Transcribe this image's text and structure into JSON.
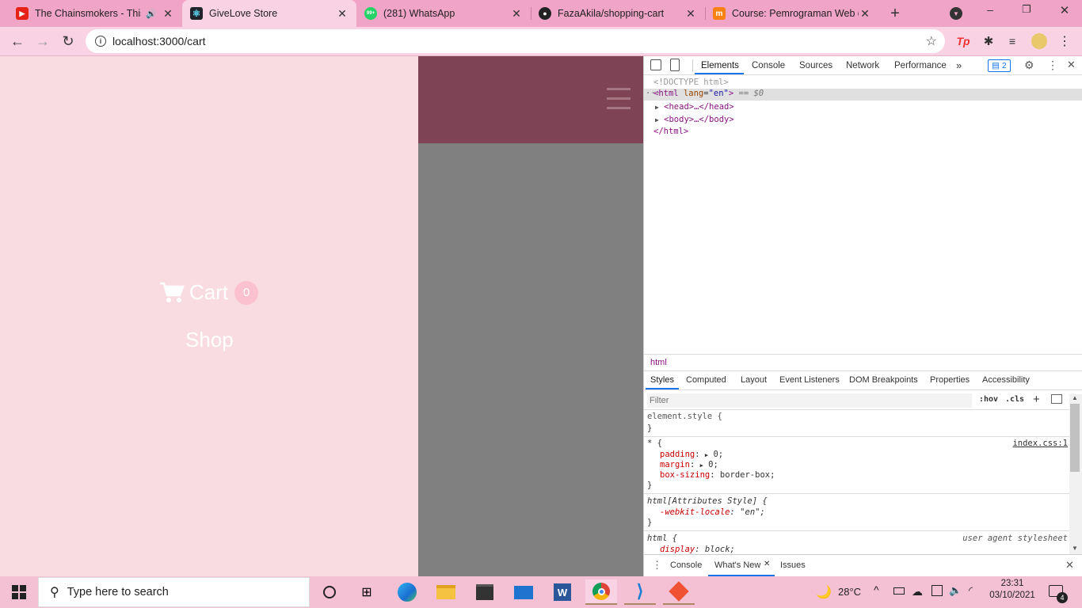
{
  "browser": {
    "tabs": [
      {
        "title": "The Chainsmokers - This",
        "icon": "youtube-icon"
      },
      {
        "title": "GiveLove Store",
        "icon": "react-icon"
      },
      {
        "title": "(281) WhatsApp",
        "icon": "whatsapp-icon",
        "badge": "99+"
      },
      {
        "title": "FazaAkila/shopping-cart",
        "icon": "github-icon"
      },
      {
        "title": "Course: Pemrograman Web d",
        "icon": "moodle-icon"
      }
    ],
    "url": "localhost:3000/cart",
    "profile_ext": "Tp"
  },
  "page": {
    "cart_label": "Cart",
    "cart_count": "0",
    "shop_label": "Shop"
  },
  "devtools": {
    "tabs": [
      "Elements",
      "Console",
      "Sources",
      "Network",
      "Performance"
    ],
    "issues_count": "2",
    "dom": {
      "doctype": "<!DOCTYPE html>",
      "html_open": "<html",
      "html_attr": "lang",
      "html_attr_val": "\"en\"",
      "html_close_bracket": ">",
      "selected_marker": "== $0",
      "head": "<head>…</head>",
      "body": "<body>…</body>",
      "html_end": "</html>"
    },
    "breadcrumb": "html",
    "styles_tabs": [
      "Styles",
      "Computed",
      "Layout",
      "Event Listeners",
      "DOM Breakpoints",
      "Properties",
      "Accessibility"
    ],
    "filter_placeholder": "Filter",
    "hov": ":hov",
    "cls": ".cls",
    "rules": {
      "element_style": "element.style {",
      "star_selector": "* {",
      "star_source": "index.css:1",
      "padding_prop": "padding",
      "padding_val": "0;",
      "margin_prop": "margin",
      "margin_val": "0;",
      "boxsizing_prop": "box-sizing",
      "boxsizing_val": "border-box;",
      "attr_selector": "html[Attributes Style] {",
      "locale_prop": "-webkit-locale",
      "locale_val": "\"en\";",
      "html_selector": "html {",
      "ua_source": "user agent stylesheet",
      "display_prop": "display",
      "display_val": "block;",
      "close_brace": "}"
    },
    "drawer_tabs": [
      "Console",
      "What's New",
      "Issues"
    ]
  },
  "taskbar": {
    "search_placeholder": "Type here to search",
    "temperature": "28°C",
    "time": "23:31",
    "date": "03/10/2021",
    "notification_count": "4"
  }
}
